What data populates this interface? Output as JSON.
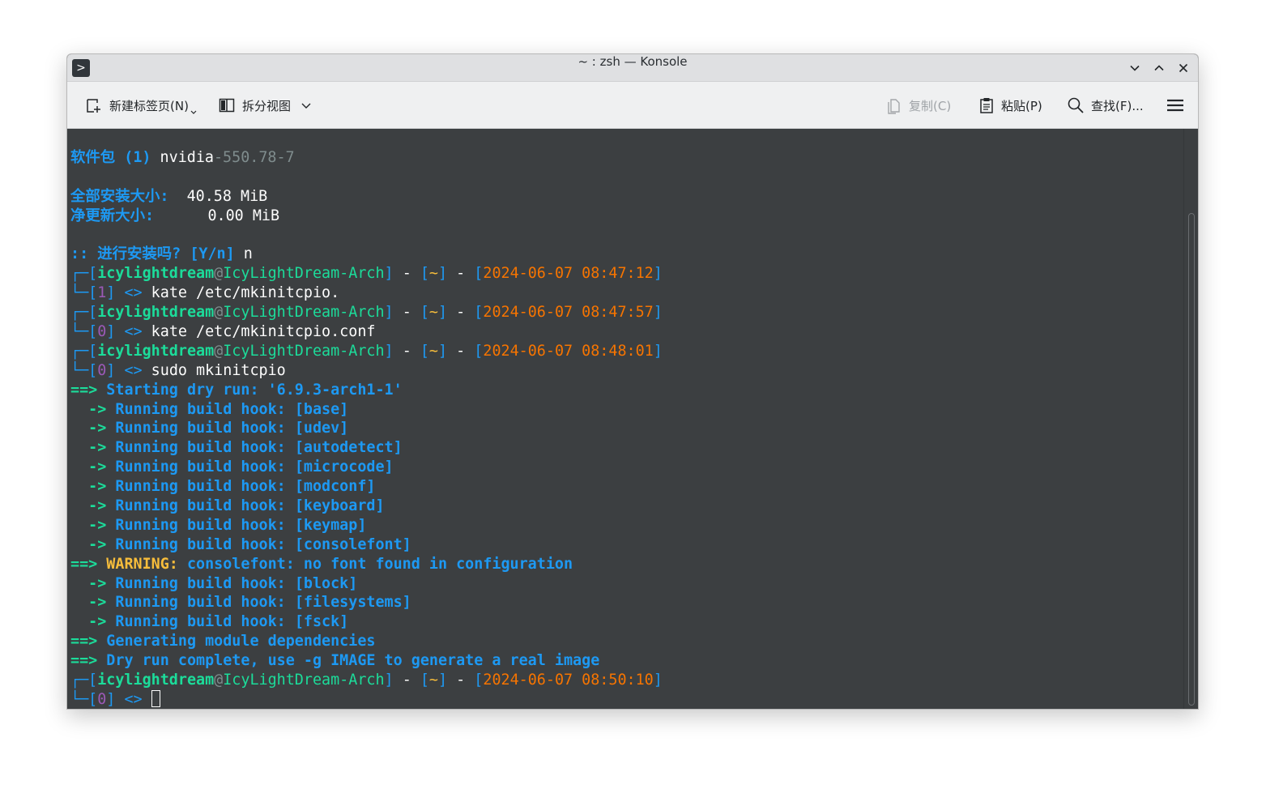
{
  "window": {
    "title": "~ : zsh — Konsole",
    "app_icon_glyph": ">"
  },
  "toolbar": {
    "new_tab": "新建标签页(N)",
    "split_view": "拆分视图",
    "copy": "复制(C)",
    "paste": "粘贴(P)",
    "find": "查找(F)..."
  },
  "terminal": {
    "pkg_label": "软件包 (1)",
    "pkg_name": "nvidia",
    "pkg_version": "-550.78-7",
    "install_size_label": "全部安装大小:",
    "install_size_value": "  40.58 MiB",
    "net_size_label": "净更新大小:",
    "net_size_value": "      0.00 MiB",
    "confirm_prefix": ":: 进行安装吗? [Y/n]",
    "confirm_answer": " n",
    "user": "icylightdream",
    "at": "@",
    "host": "IcyLightDream-Arch",
    "dir": "~",
    "sep": " - ",
    "prompt_arrow": " <> ",
    "prompts": [
      {
        "time": "2024-06-07 08:47:12",
        "code": "1",
        "command": "kate /etc/mkinitcpio."
      },
      {
        "time": "2024-06-07 08:47:57",
        "code": "0",
        "command": "kate /etc/mkinitcpio.conf"
      },
      {
        "time": "2024-06-07 08:48:01",
        "code": "0",
        "command": "sudo mkinitcpio"
      }
    ],
    "output": [
      {
        "prefix": "==> ",
        "text": "Starting dry run: '6.9.3-arch1-1'"
      },
      {
        "prefix": "  -> ",
        "text": "Running build hook: [base]"
      },
      {
        "prefix": "  -> ",
        "text": "Running build hook: [udev]"
      },
      {
        "prefix": "  -> ",
        "text": "Running build hook: [autodetect]"
      },
      {
        "prefix": "  -> ",
        "text": "Running build hook: [microcode]"
      },
      {
        "prefix": "  -> ",
        "text": "Running build hook: [modconf]"
      },
      {
        "prefix": "  -> ",
        "text": "Running build hook: [keyboard]"
      },
      {
        "prefix": "  -> ",
        "text": "Running build hook: [keymap]"
      },
      {
        "prefix": "  -> ",
        "text": "Running build hook: [consolefont]"
      },
      {
        "prefix": "==> ",
        "warning": "WARNING:",
        "text": " consolefont: no font found in configuration"
      },
      {
        "prefix": "  -> ",
        "text": "Running build hook: [block]"
      },
      {
        "prefix": "  -> ",
        "text": "Running build hook: [filesystems]"
      },
      {
        "prefix": "  -> ",
        "text": "Running build hook: [fsck]"
      },
      {
        "prefix": "==> ",
        "text": "Generating module dependencies"
      },
      {
        "prefix": "==> ",
        "text": "Dry run complete, use -g IMAGE to generate a real image"
      }
    ],
    "final_prompt": {
      "time": "2024-06-07 08:50:10",
      "code": "0"
    }
  },
  "colors": {
    "blue": "#1d99f3",
    "green": "#1cdc9a",
    "yellow": "#f7bd3b",
    "orange": "#f67400",
    "magenta": "#9b59b6",
    "background": "#3c3f41"
  },
  "icons": [
    "konsole-app-icon",
    "minimize-icon",
    "maximize-icon",
    "close-icon",
    "new-tab-icon",
    "split-view-icon",
    "copy-icon",
    "paste-icon",
    "search-icon",
    "hamburger-menu-icon"
  ]
}
